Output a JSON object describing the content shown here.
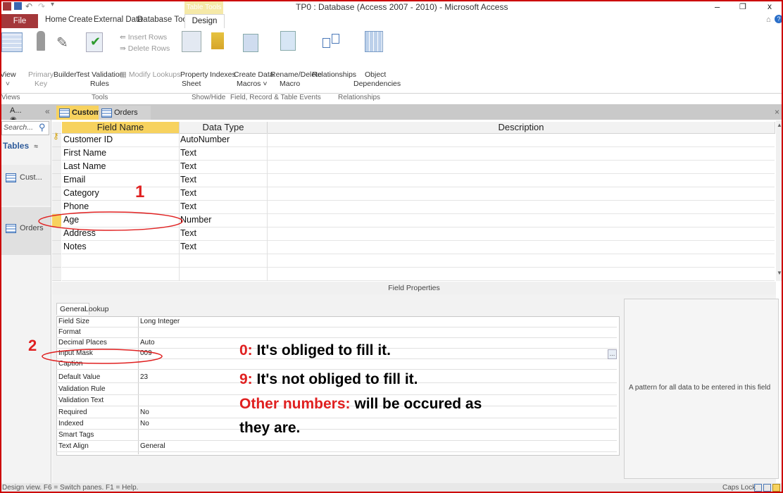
{
  "window": {
    "title": "TP0 : Database (Access 2007 - 2010) - Microsoft Access",
    "context_tab_group": "Table Tools",
    "controls": {
      "minimize": "–",
      "restore": "❐",
      "close": "x"
    }
  },
  "ribbon_tabs": {
    "file": "File",
    "home": "Home",
    "create": "Create",
    "external_data": "External Data",
    "database_tools": "Database Tools",
    "design": "Design"
  },
  "ribbon": {
    "view": "View",
    "primary_key_1": "Primary",
    "primary_key_2": "Key",
    "builder": "Builder",
    "test_validation_1": "Test Validation",
    "test_validation_2": "Rules",
    "insert_rows": "Insert Rows",
    "delete_rows": "Delete Rows",
    "modify_lookups": "Modify Lookups",
    "property_sheet_1": "Property",
    "property_sheet_2": "Sheet",
    "indexes": "Indexes",
    "create_data_macros_1": "Create Data",
    "create_data_macros_2": "Macros ˅",
    "rename_delete_macro_1": "Rename/Delete",
    "rename_delete_macro_2": "Macro",
    "relationships": "Relationships",
    "object_dependencies_1": "Object",
    "object_dependencies_2": "Dependencies",
    "groups": {
      "views": "Views",
      "tools": "Tools",
      "show_hide": "Show/Hide",
      "field_record_events": "Field, Record & Table Events",
      "relationships": "Relationships"
    }
  },
  "nav_pane": {
    "header": "A...",
    "search_placeholder": "Search...",
    "section": "Tables",
    "items": [
      {
        "label": "Cust..."
      },
      {
        "label": "Orders"
      }
    ]
  },
  "doc_tabs": [
    {
      "label": "Customers",
      "active": true
    },
    {
      "label": "Orders",
      "active": false
    }
  ],
  "grid": {
    "columns": [
      "Field Name",
      "Data Type",
      "Description"
    ],
    "rows": [
      {
        "field": "Customer ID",
        "type": "AutoNumber"
      },
      {
        "field": "First Name",
        "type": "Text"
      },
      {
        "field": "Last Name",
        "type": "Text"
      },
      {
        "field": "Email",
        "type": "Text"
      },
      {
        "field": "Category",
        "type": "Text"
      },
      {
        "field": "Phone",
        "type": "Text"
      },
      {
        "field": "Age",
        "type": "Number"
      },
      {
        "field": "Address",
        "type": "Text"
      },
      {
        "field": "Notes",
        "type": "Text"
      }
    ]
  },
  "field_properties": {
    "header": "Field Properties",
    "tabs": [
      "General",
      "Lookup"
    ],
    "rows": [
      {
        "name": "Field Size",
        "value": "Long Integer"
      },
      {
        "name": "Format",
        "value": ""
      },
      {
        "name": "Decimal Places",
        "value": "Auto"
      },
      {
        "name": "Input Mask",
        "value": "009"
      },
      {
        "name": "Caption",
        "value": ""
      },
      {
        "name": "Default Value",
        "value": "23"
      },
      {
        "name": "Validation Rule",
        "value": ""
      },
      {
        "name": "Validation Text",
        "value": ""
      },
      {
        "name": "Required",
        "value": "No"
      },
      {
        "name": "Indexed",
        "value": "No"
      },
      {
        "name": "Smart Tags",
        "value": ""
      },
      {
        "name": "Text Align",
        "value": "General"
      }
    ],
    "help_text": "A pattern for all data to be entered in this field"
  },
  "annotations": {
    "marker_1": "1",
    "marker_2": "2",
    "line1_key": "0:",
    "line1_text": "It's obliged to fill it.",
    "line2_key": "9:",
    "line2_text": "It's not obliged to fill it.",
    "line3_key": "Other numbers:",
    "line3_text": "will be occured as",
    "line4_text": "they are."
  },
  "status_bar": {
    "left": "Design view.  F6 = Switch panes.  F1 = Help.",
    "caps_lock": "Caps Lock"
  },
  "colors": {
    "file_tab": "#a4373a",
    "annotation_red": "#e02020",
    "active_doc_tab": "#f7d25e"
  }
}
